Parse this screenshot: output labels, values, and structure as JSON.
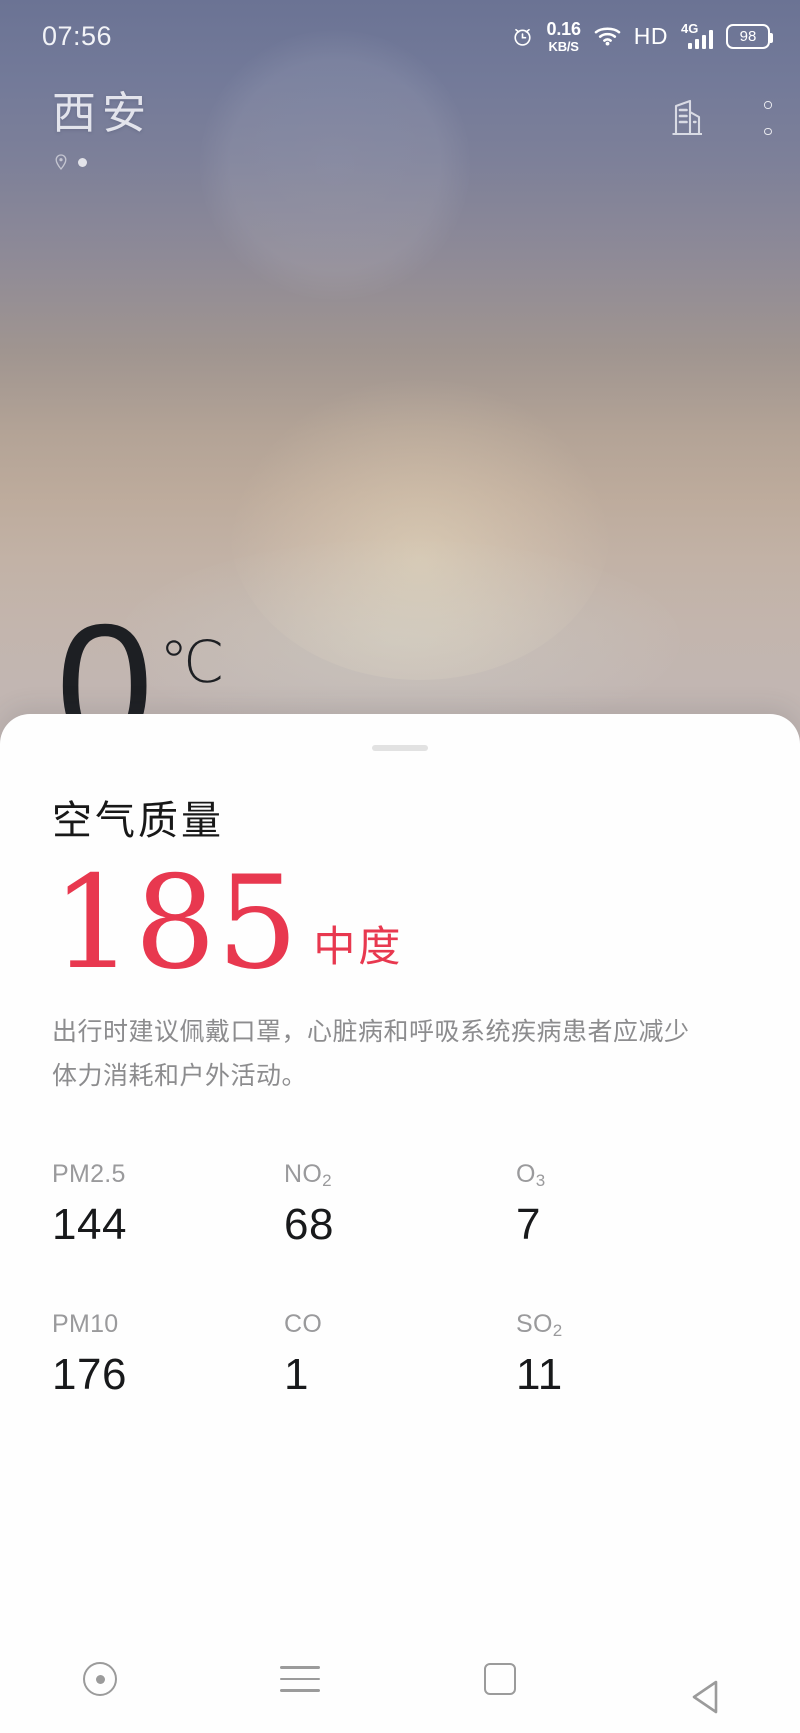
{
  "status_bar": {
    "time": "07:56",
    "alarm_icon": "alarm-clock-icon",
    "network_speed_value": "0.16",
    "network_speed_unit": "KB/S",
    "wifi_icon": "wifi-icon",
    "hd_label": "HD",
    "network_type": "4G",
    "signal_icon": "cellular-signal-icon",
    "battery_level": "98"
  },
  "weather_header": {
    "city": "西安",
    "location_pin_icon": "location-pin-icon",
    "page_indicator_dot": "page-indicator-dot",
    "city_list_icon": "city-list-icon",
    "more_icon": "more-vertical-icon"
  },
  "current": {
    "temperature": "0",
    "temperature_unit": "℃"
  },
  "air_quality": {
    "title": "空气质量",
    "aqi_value": "185",
    "level": "中度",
    "accent_color": "#e8384f",
    "advice": "出行时建议佩戴口罩，心脏病和呼吸系统疾病患者应减少体力消耗和户外活动。",
    "pollutants": [
      {
        "name": "PM2.5",
        "sub": "",
        "value": "144"
      },
      {
        "name": "NO",
        "sub": "2",
        "value": "68"
      },
      {
        "name": "O",
        "sub": "3",
        "value": "7"
      },
      {
        "name": "PM10",
        "sub": "",
        "value": "176"
      },
      {
        "name": "CO",
        "sub": "",
        "value": "1"
      },
      {
        "name": "SO",
        "sub": "2",
        "value": "11"
      }
    ]
  },
  "nav_bar": {
    "assistant_icon": "assistant-circle-icon",
    "recents_icon": "recents-menu-icon",
    "home_icon": "home-square-icon",
    "back_icon": "back-triangle-icon"
  }
}
